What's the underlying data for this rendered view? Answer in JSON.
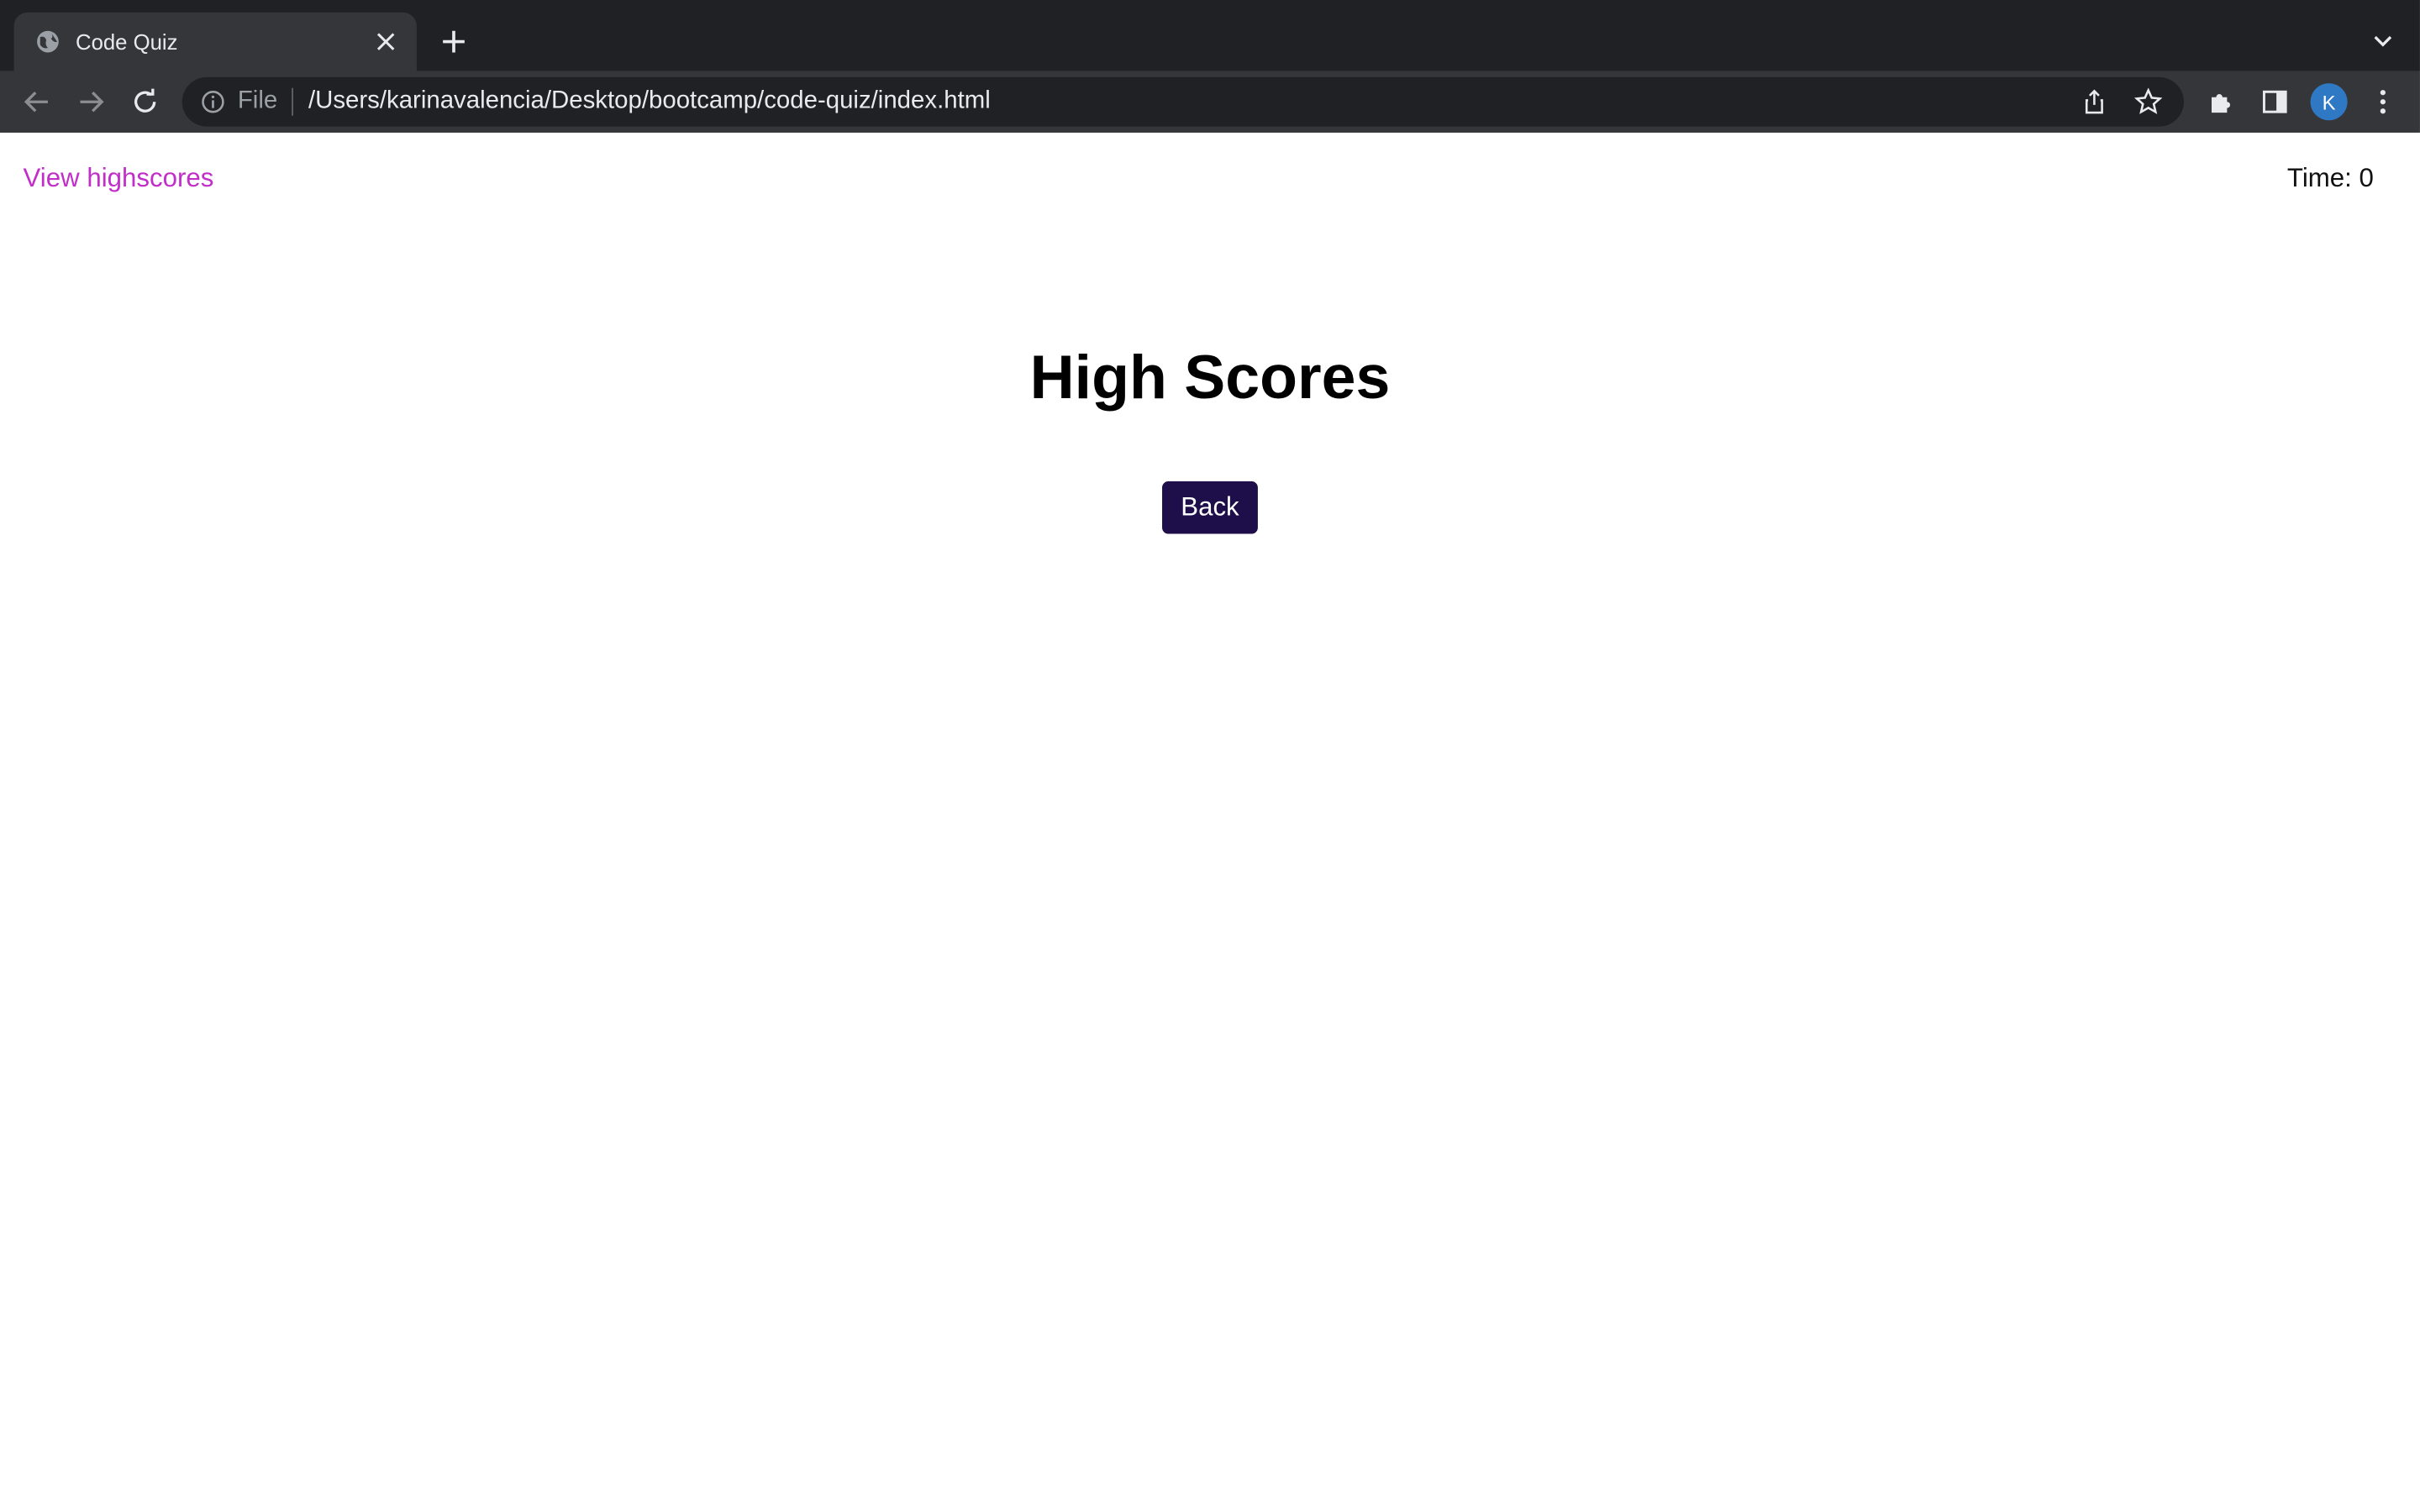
{
  "browser": {
    "tab": {
      "title": "Code Quiz"
    },
    "omnibox": {
      "scheme_label": "File",
      "url": "/Users/karinavalencia/Desktop/bootcamp/code-quiz/index.html"
    },
    "profile_initial": "K",
    "icons": [
      "globe-icon",
      "close-icon",
      "plus-icon",
      "chevron-down-icon",
      "back-arrow-icon",
      "forward-arrow-icon",
      "reload-icon",
      "info-icon",
      "share-icon",
      "star-icon",
      "puzzle-icon",
      "side-panel-icon",
      "kebab-menu-icon"
    ],
    "colors": {
      "tabstrip": "#202124",
      "toolbar": "#35363a",
      "avatar": "#2f78c4"
    }
  },
  "page": {
    "view_highscores": "View highscores",
    "timer": "Time: 0",
    "heading": "High Scores",
    "back_label": "Back",
    "colors": {
      "link": "#c22ec8",
      "button": "#1e0f4a"
    }
  }
}
